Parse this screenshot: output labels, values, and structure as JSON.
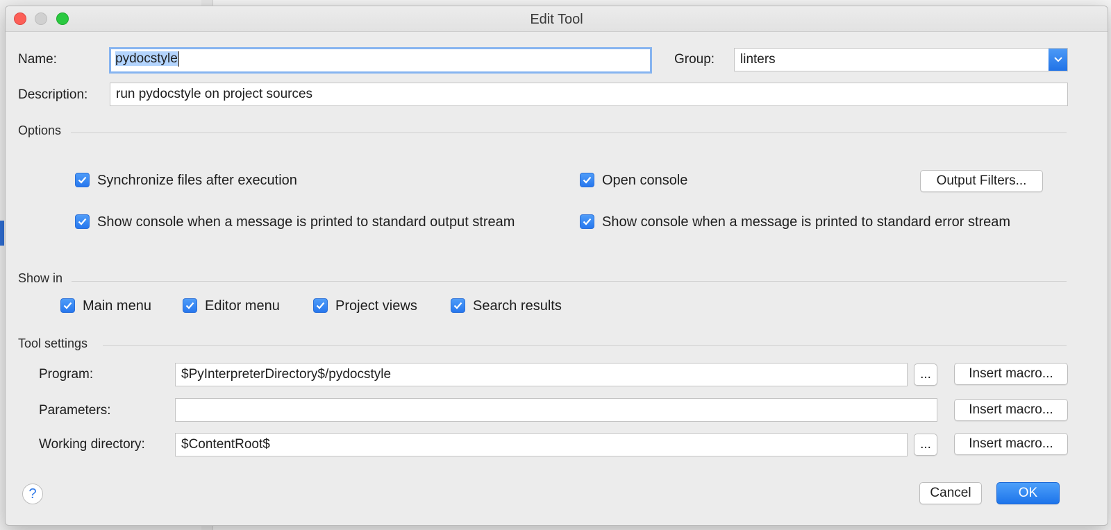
{
  "window": {
    "title": "Edit Tool"
  },
  "name": {
    "label": "Name:",
    "value": "pydocstyle"
  },
  "group": {
    "label": "Group:",
    "value": "linters"
  },
  "description": {
    "label": "Description:",
    "value": "run pydocstyle on project sources"
  },
  "options": {
    "heading": "Options",
    "sync_files": {
      "label": "Synchronize files after execution",
      "checked": true
    },
    "open_console": {
      "label": "Open console",
      "checked": true
    },
    "output_filters_label": "Output Filters...",
    "show_console_stdout": {
      "label": "Show console when a message is printed to standard output stream",
      "checked": true
    },
    "show_console_stderr": {
      "label": "Show console when a message is printed to standard error stream",
      "checked": true
    }
  },
  "show_in": {
    "heading": "Show in",
    "items": [
      {
        "label": "Main menu",
        "checked": true
      },
      {
        "label": "Editor menu",
        "checked": true
      },
      {
        "label": "Project views",
        "checked": true
      },
      {
        "label": "Search results",
        "checked": true
      }
    ]
  },
  "tool_settings": {
    "heading": "Tool settings",
    "program": {
      "label": "Program:",
      "value": "$PyInterpreterDirectory$/pydocstyle"
    },
    "parameters": {
      "label": "Parameters:",
      "value": ""
    },
    "working_directory": {
      "label": "Working directory:",
      "value": "$ContentRoot$"
    },
    "browse_label": "...",
    "insert_macro_label": "Insert macro..."
  },
  "footer": {
    "help_label": "?",
    "cancel_label": "Cancel",
    "ok_label": "OK"
  },
  "colors": {
    "accent": "#2777ee",
    "selection": "#b3d4fd",
    "focus_ring": "#86b4f0"
  }
}
